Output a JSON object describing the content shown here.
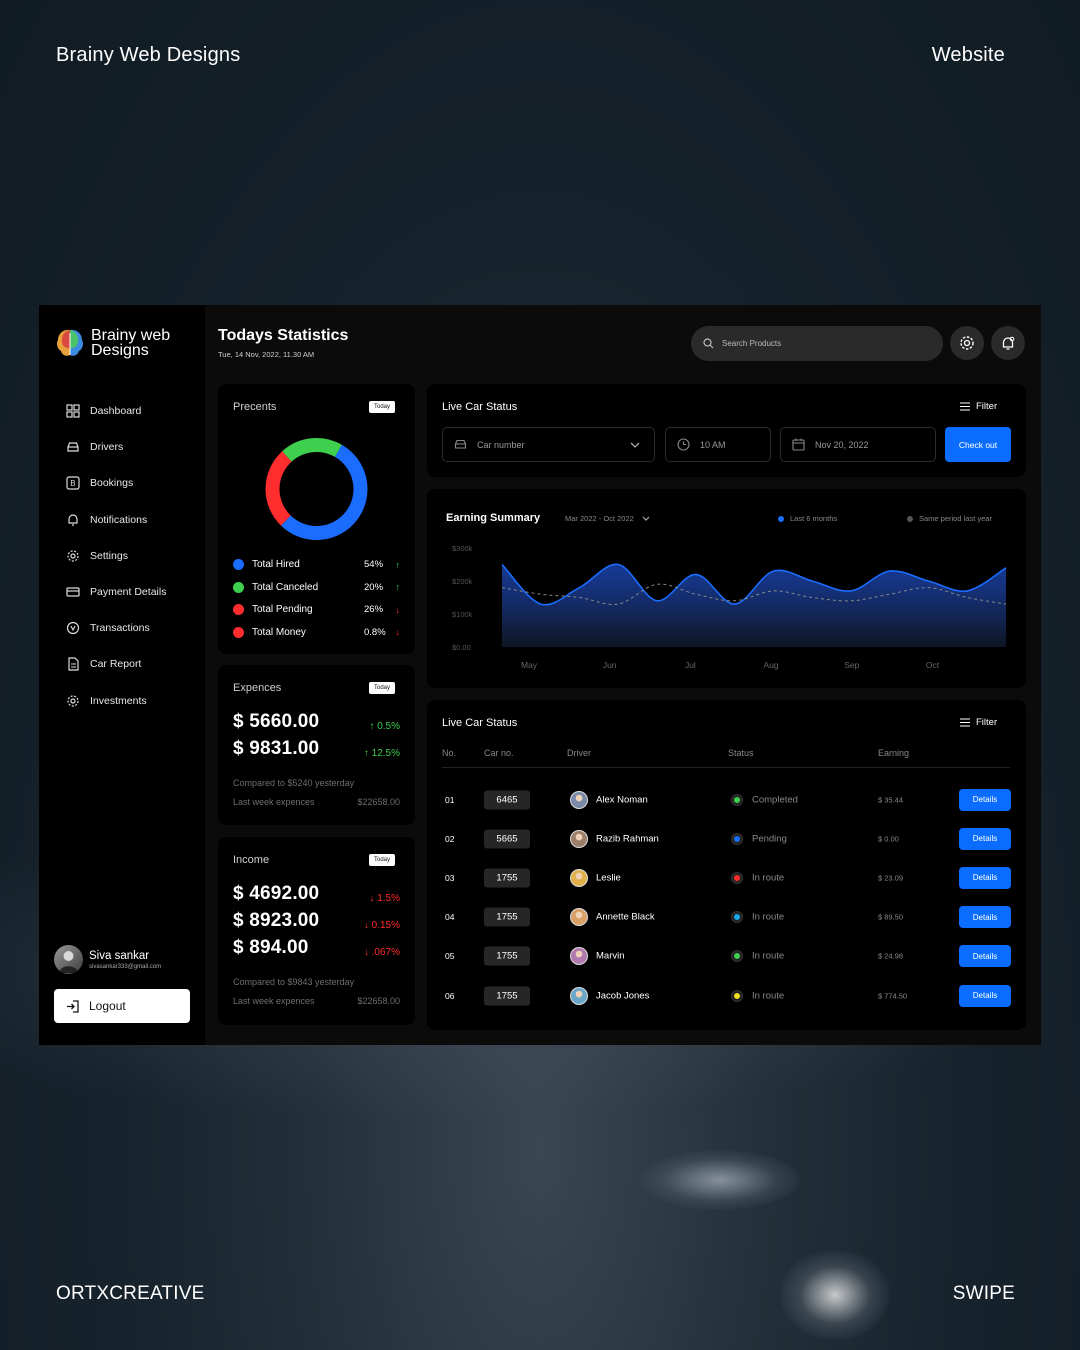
{
  "overlay": {
    "top_left": "Brainy Web Designs",
    "top_right": "Website",
    "bottom_left": "ORTXCREATIVE",
    "bottom_right": "SWIPE"
  },
  "brand": {
    "name": "Brainy web Designs"
  },
  "sidebar": {
    "items": [
      {
        "label": "Dashboard",
        "icon": "grid-icon"
      },
      {
        "label": "Drivers",
        "icon": "car-icon"
      },
      {
        "label": "Bookings",
        "icon": "booking-icon"
      },
      {
        "label": "Notifications",
        "icon": "bell-icon"
      },
      {
        "label": "Settings",
        "icon": "gear-icon"
      },
      {
        "label": "Payment Details",
        "icon": "card-icon"
      },
      {
        "label": "Transactions",
        "icon": "transaction-icon"
      },
      {
        "label": "Car Report",
        "icon": "report-icon"
      },
      {
        "label": "Investments",
        "icon": "investment-icon"
      }
    ],
    "user": {
      "name": "Siva sankar",
      "email": "sivasankar333@gmail.com"
    },
    "logout_label": "Logout"
  },
  "header": {
    "title": "Todays Statistics",
    "date": "Tue, 14 Nov, 2022, 11.30 AM",
    "search_placeholder": "Search Products"
  },
  "precents": {
    "title": "Precents",
    "badge": "Today",
    "donut": [
      {
        "label": "Total Hired",
        "value": 54,
        "color": "#1a6dff"
      },
      {
        "label": "Total Pending",
        "value": 26,
        "color": "#ff2d2d"
      },
      {
        "label": "Total Canceled",
        "value": 20,
        "color": "#3ecf4f"
      }
    ],
    "rows": [
      {
        "label": "Total Hired",
        "pct": "54%",
        "color": "#1a6dff",
        "arrow": "↑",
        "arrow_color": "#3ecf4f"
      },
      {
        "label": "Total Canceled",
        "pct": "20%",
        "color": "#3ecf4f",
        "arrow": "↑",
        "arrow_color": "#3ecf4f"
      },
      {
        "label": "Total Pending",
        "pct": "26%",
        "color": "#ff2d2d",
        "arrow": "↓",
        "arrow_color": "#ff2d2d"
      },
      {
        "label": "Total Money",
        "pct": "0.8%",
        "color": "#ff2d2d",
        "arrow": "↓",
        "arrow_color": "#ff2d2d"
      }
    ]
  },
  "expences": {
    "title": "Expences",
    "badge": "Today",
    "amounts": [
      {
        "value": "$ 5660.00",
        "change": "↑ 0.5%"
      },
      {
        "value": "$ 9831.00",
        "change": "↑ 12.5%"
      }
    ],
    "compared": "Compared to $5240 yesterday",
    "last_week_label": "Last week expences",
    "last_week_value": "$22658.00"
  },
  "income": {
    "title": "Income",
    "badge": "Today",
    "amounts": [
      {
        "value": "$ 4692.00",
        "change": "↓ 1.5%"
      },
      {
        "value": "$ 8923.00",
        "change": "↓ 0.15%"
      },
      {
        "value": "$ 894.00",
        "change": "↓ .067%"
      }
    ],
    "compared": "Compared to $9843 yesterday",
    "last_week_label": "Last week expences",
    "last_week_value": "$22658.00"
  },
  "live_status": {
    "title": "Live Car Status",
    "filter_label": "Filter",
    "car_number_placeholder": "Car number",
    "time_value": "10 AM",
    "date_value": "Nov 20, 2022",
    "checkout_label": "Check out"
  },
  "earning": {
    "title": "Earning Summary",
    "range": "Mar 2022 - Oct 2022",
    "legend_current": "Last 6 months",
    "legend_previous": "Same period last year"
  },
  "chart_data": {
    "type": "area",
    "title": "Earning Summary",
    "x_ticks": [
      "May",
      "Jun",
      "Jul",
      "Aug",
      "Sep",
      "Oct"
    ],
    "y_ticks": [
      "$300k",
      "$200k",
      "$100k",
      "$0.00"
    ],
    "ylim": [
      0,
      300000
    ],
    "x": [
      0,
      0.5,
      1,
      1.5,
      2,
      2.5,
      3,
      3.5,
      4,
      4.5,
      5,
      5.5,
      6,
      6.5
    ],
    "series": [
      {
        "name": "Last 6 months",
        "color": "#1a6dff",
        "values": [
          250000,
          130000,
          180000,
          250000,
          140000,
          220000,
          130000,
          230000,
          200000,
          170000,
          230000,
          200000,
          170000,
          240000
        ]
      },
      {
        "name": "Same period last year",
        "color": "#888888",
        "values": [
          180000,
          160000,
          150000,
          130000,
          190000,
          160000,
          140000,
          170000,
          150000,
          140000,
          160000,
          180000,
          150000,
          130000
        ]
      }
    ],
    "grid": false,
    "legend": "top-right"
  },
  "table": {
    "title": "Live Car Status",
    "filter_label": "Filter",
    "headers": [
      "No.",
      "Car no.",
      "Driver",
      "Status",
      "Earning"
    ],
    "details_label": "Details",
    "rows": [
      {
        "no": "01",
        "car": "6465",
        "driver": "Alex Noman",
        "status": "Completed",
        "status_color": "#3ecf4f",
        "earning": "$ 35.44",
        "avatar": "#7a8aa8"
      },
      {
        "no": "02",
        "car": "5665",
        "driver": "Razib Rahman",
        "status": "Pending",
        "status_color": "#1a6dff",
        "earning": "$ 0.00",
        "avatar": "#9e7f6b"
      },
      {
        "no": "03",
        "car": "1755",
        "driver": "Leslie",
        "status": "In route",
        "status_color": "#ff2d2d",
        "earning": "$ 23.09",
        "avatar": "#e0b04a"
      },
      {
        "no": "04",
        "car": "1755",
        "driver": "Annette Black",
        "status": "In route",
        "status_color": "#16a6e8",
        "earning": "$ 89.50",
        "avatar": "#d9a068"
      },
      {
        "no": "05",
        "car": "1755",
        "driver": "Marvin",
        "status": "In route",
        "status_color": "#3ecf4f",
        "earning": "$ 24.98",
        "avatar": "#b07ab0"
      },
      {
        "no": "06",
        "car": "1755",
        "driver": "Jacob Jones",
        "status": "In route",
        "status_color": "#f0e020",
        "earning": "$ 774.50",
        "avatar": "#6aa6c8"
      }
    ]
  }
}
